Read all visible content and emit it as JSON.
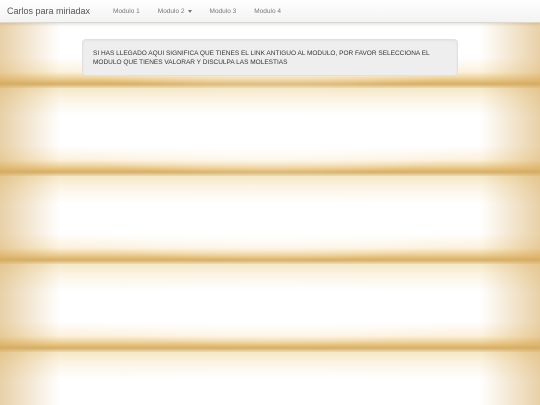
{
  "navbar": {
    "brand": "Carlos para miriadax",
    "items": [
      {
        "label": "Modulo 1",
        "has_dropdown": false
      },
      {
        "label": "Modulo 2",
        "has_dropdown": true
      },
      {
        "label": "Modulo 3",
        "has_dropdown": false
      },
      {
        "label": "Modulo 4",
        "has_dropdown": false
      }
    ]
  },
  "notice": {
    "text": "SI HAS LLEGADO AQUI SIGNIFICA QUE TIENES EL LINK ANTIGUO AL MODULO, POR FAVOR SELECCIONA EL MODULO QUE TIENES VALORAR Y DISCULPA LAS MOLESTIAS"
  },
  "colors": {
    "navbar_bg": "#f8f8f8",
    "brand_text": "#555555",
    "nav_text": "#777777",
    "notice_bg": "#eeeeee",
    "background_tone": "#d8ae63"
  }
}
